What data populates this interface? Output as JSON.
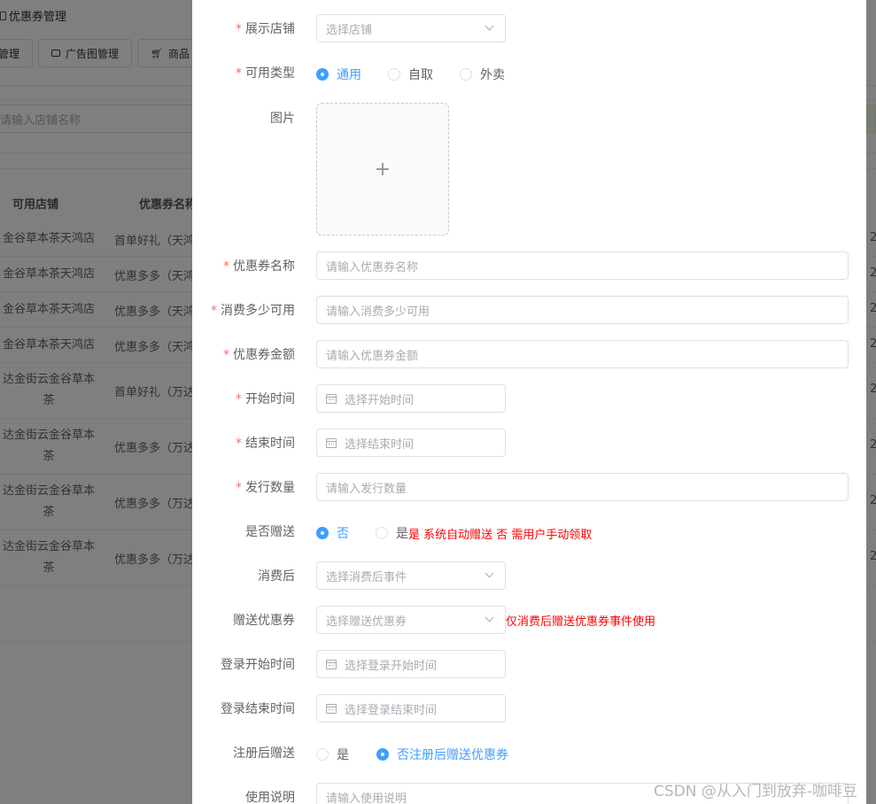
{
  "background": {
    "page_title": "优惠券管理",
    "tabs": [
      {
        "label": "店管理"
      },
      {
        "label": "广告图管理"
      },
      {
        "label": "商品"
      }
    ],
    "search_placeholder": "请输入店铺名称",
    "table": {
      "headers": [
        "可用店铺",
        "优惠券名称"
      ],
      "rows": [
        {
          "store": "金谷草本茶天鸿店",
          "coupon": "首单好礼（天鸿",
          "extra": "2"
        },
        {
          "store": "金谷草本茶天鸿店",
          "coupon": "优惠多多（天鸿",
          "extra": "2"
        },
        {
          "store": "金谷草本茶天鸿店",
          "coupon": "优惠多多（天鸿",
          "extra": "2"
        },
        {
          "store": "金谷草本茶天鸿店",
          "coupon": "优惠多多（天鸿",
          "extra": "2"
        },
        {
          "store": "达金街云金谷草本茶",
          "coupon": "首单好礼（万达",
          "extra": "2"
        },
        {
          "store": "达金街云金谷草本茶",
          "coupon": "优惠多多（万达",
          "extra": "2"
        },
        {
          "store": "达金街云金谷草本茶",
          "coupon": "优惠多多（万达",
          "extra": "2"
        },
        {
          "store": "达金街云金谷草本茶",
          "coupon": "优惠多多（万达",
          "extra": "2"
        }
      ]
    }
  },
  "form": {
    "store": {
      "label": "展示店铺",
      "placeholder": "选择店铺"
    },
    "type": {
      "label": "可用类型",
      "options": [
        "通用",
        "自取",
        "外卖"
      ],
      "selected": "通用"
    },
    "image": {
      "label": "图片",
      "plus": "+"
    },
    "name": {
      "label": "优惠券名称",
      "placeholder": "请输入优惠券名称"
    },
    "min_spend": {
      "label": "消费多少可用",
      "placeholder": "请输入消费多少可用"
    },
    "amount": {
      "label": "优惠券金额",
      "placeholder": "请输入优惠券金额"
    },
    "start": {
      "label": "开始时间",
      "placeholder": "选择开始时间"
    },
    "end": {
      "label": "结束时间",
      "placeholder": "选择结束时间"
    },
    "quantity": {
      "label": "发行数量",
      "placeholder": "请输入发行数量"
    },
    "gift": {
      "label": "是否赠送",
      "options": [
        "否",
        "是"
      ],
      "selected": "否",
      "hint": "是 系统自动赠送 否 需用户手动领取"
    },
    "after_spend": {
      "label": "消费后",
      "placeholder": "选择消费后事件"
    },
    "gift_coupon": {
      "label": "赠送优惠券",
      "placeholder": "选择赠送优惠券",
      "hint": "仅消费后赠送优惠券事件使用"
    },
    "login_start": {
      "label": "登录开始时间",
      "placeholder": "选择登录开始时间"
    },
    "login_end": {
      "label": "登录结束时间",
      "placeholder": "选择登录结束时间"
    },
    "register_gift": {
      "label": "注册后赠送",
      "options": [
        "是",
        "否"
      ],
      "selected": "否",
      "hint": "注册后赠送优惠券"
    },
    "usage": {
      "label": "使用说明",
      "placeholder": "请输入使用说明"
    }
  },
  "watermark": "CSDN @从入门到放弃-咖啡豆",
  "colors": {
    "primary": "#409eff",
    "required": "#f56c6c",
    "hint": "#ff0000",
    "overlay": "rgba(0,0,0,0.5)"
  }
}
